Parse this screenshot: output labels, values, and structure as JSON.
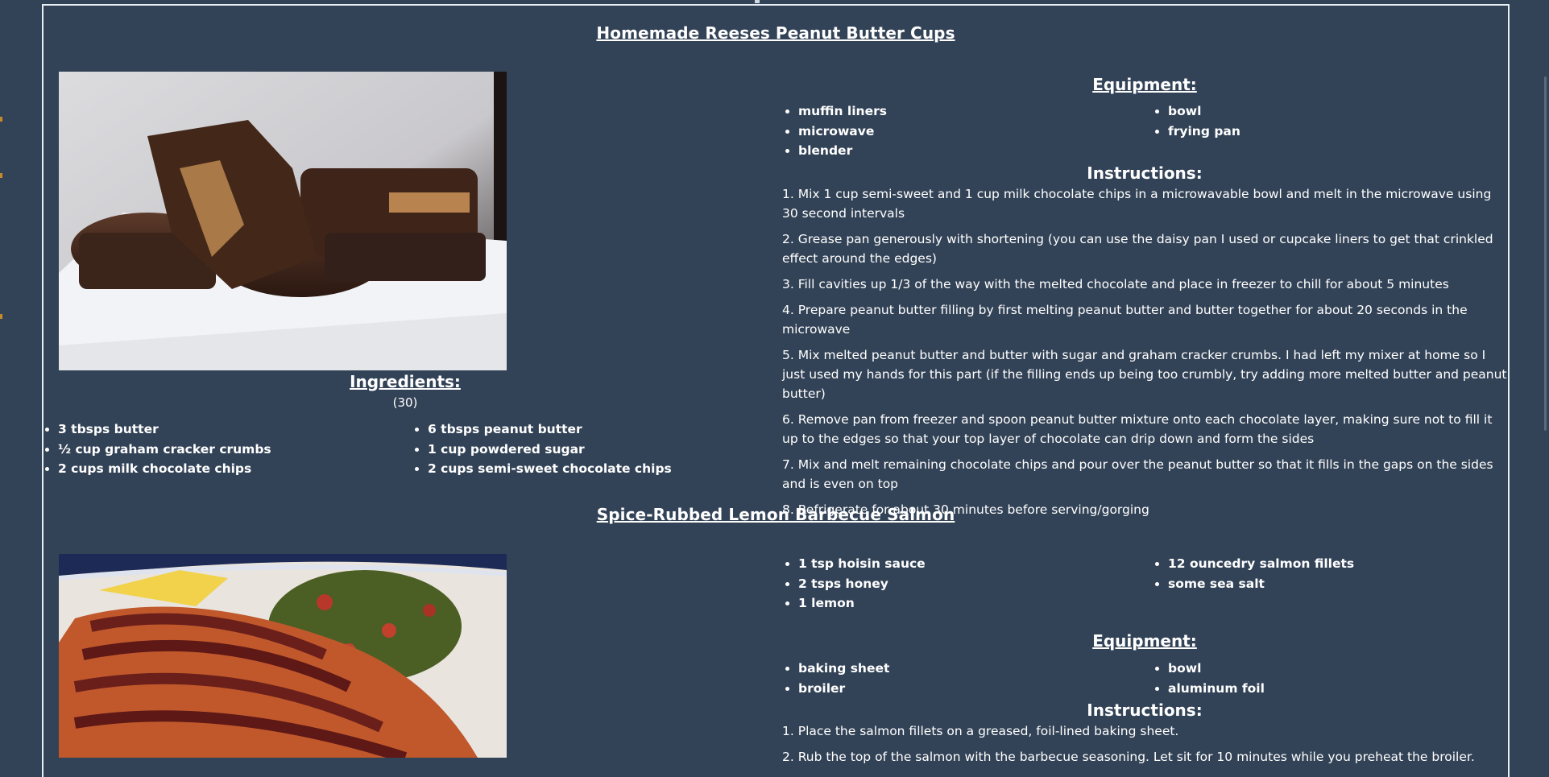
{
  "recipes": [
    {
      "title": "Homemade Reeses Peanut Butter Cups",
      "image_alt": "peanut-butter-cups-photo",
      "ingredients_heading": "Ingredients:",
      "servings": "(30)",
      "ingredients_col1": [
        "3 tbsps butter",
        "½ cup graham cracker crumbs",
        "2 cups milk chocolate chips"
      ],
      "ingredients_col2": [
        "6 tbsps peanut butter",
        "1 cup powdered sugar",
        "2 cups semi-sweet chocolate chips"
      ],
      "equipment_heading": "Equipment:",
      "equipment_col1": [
        "muffin liners",
        "microwave",
        "blender"
      ],
      "equipment_col2": [
        "bowl",
        "frying pan"
      ],
      "instructions_heading": "Instructions:",
      "instructions": [
        "1.  Mix 1 cup semi-sweet and 1 cup milk chocolate chips in a microwavable bowl and melt in the microwave using 30 second intervals",
        "2.  Grease pan generously with shortening (you can use the daisy pan I used or cupcake liners to get that crinkled effect around the edges)",
        "3.  Fill cavities up 1/3 of the way with the melted chocolate and place in freezer to chill for about 5 minutes",
        "4.  Prepare peanut butter filling by first melting peanut butter and butter together for about 20 seconds in the microwave",
        "5.  Mix melted peanut butter and butter with sugar and graham cracker crumbs. I had left my mixer at home so I just used my hands for this part (if the filling ends up being too crumbly, try adding more melted butter and peanut butter)",
        "6.  Remove pan from freezer and spoon peanut butter mixture onto each chocolate layer, making sure not to fill it up to the edges so that your top layer of chocolate can drip down and form the sides",
        "7.  Mix and melt remaining chocolate chips and pour over the peanut butter so that it fills in the gaps on the sides and is even on top",
        "8.  Refrigerate for about 30 minutes before serving/gorging"
      ]
    },
    {
      "title": "Spice-Rubbed Lemon Barbecue Salmon",
      "image_alt": "salmon-photo",
      "ingredients_col1": [
        "1 tsp hoisin sauce",
        "2 tsps honey",
        "1 lemon"
      ],
      "ingredients_col2": [
        "12 ouncedry salmon fillets",
        "some sea salt"
      ],
      "equipment_heading": "Equipment:",
      "equipment_col1": [
        "baking sheet",
        "broiler"
      ],
      "equipment_col2": [
        "bowl",
        "aluminum foil"
      ],
      "instructions_heading": "Instructions:",
      "instructions": [
        "1.  Place the salmon fillets on a greased, foil-lined baking sheet.",
        "2.  Rub the top of the salmon with the barbecue seasoning. Let sit for 10 minutes while you preheat the broiler."
      ]
    }
  ],
  "colors": {
    "background": "#334357",
    "text": "#ffffff",
    "frame_border": "#e8eef5"
  }
}
